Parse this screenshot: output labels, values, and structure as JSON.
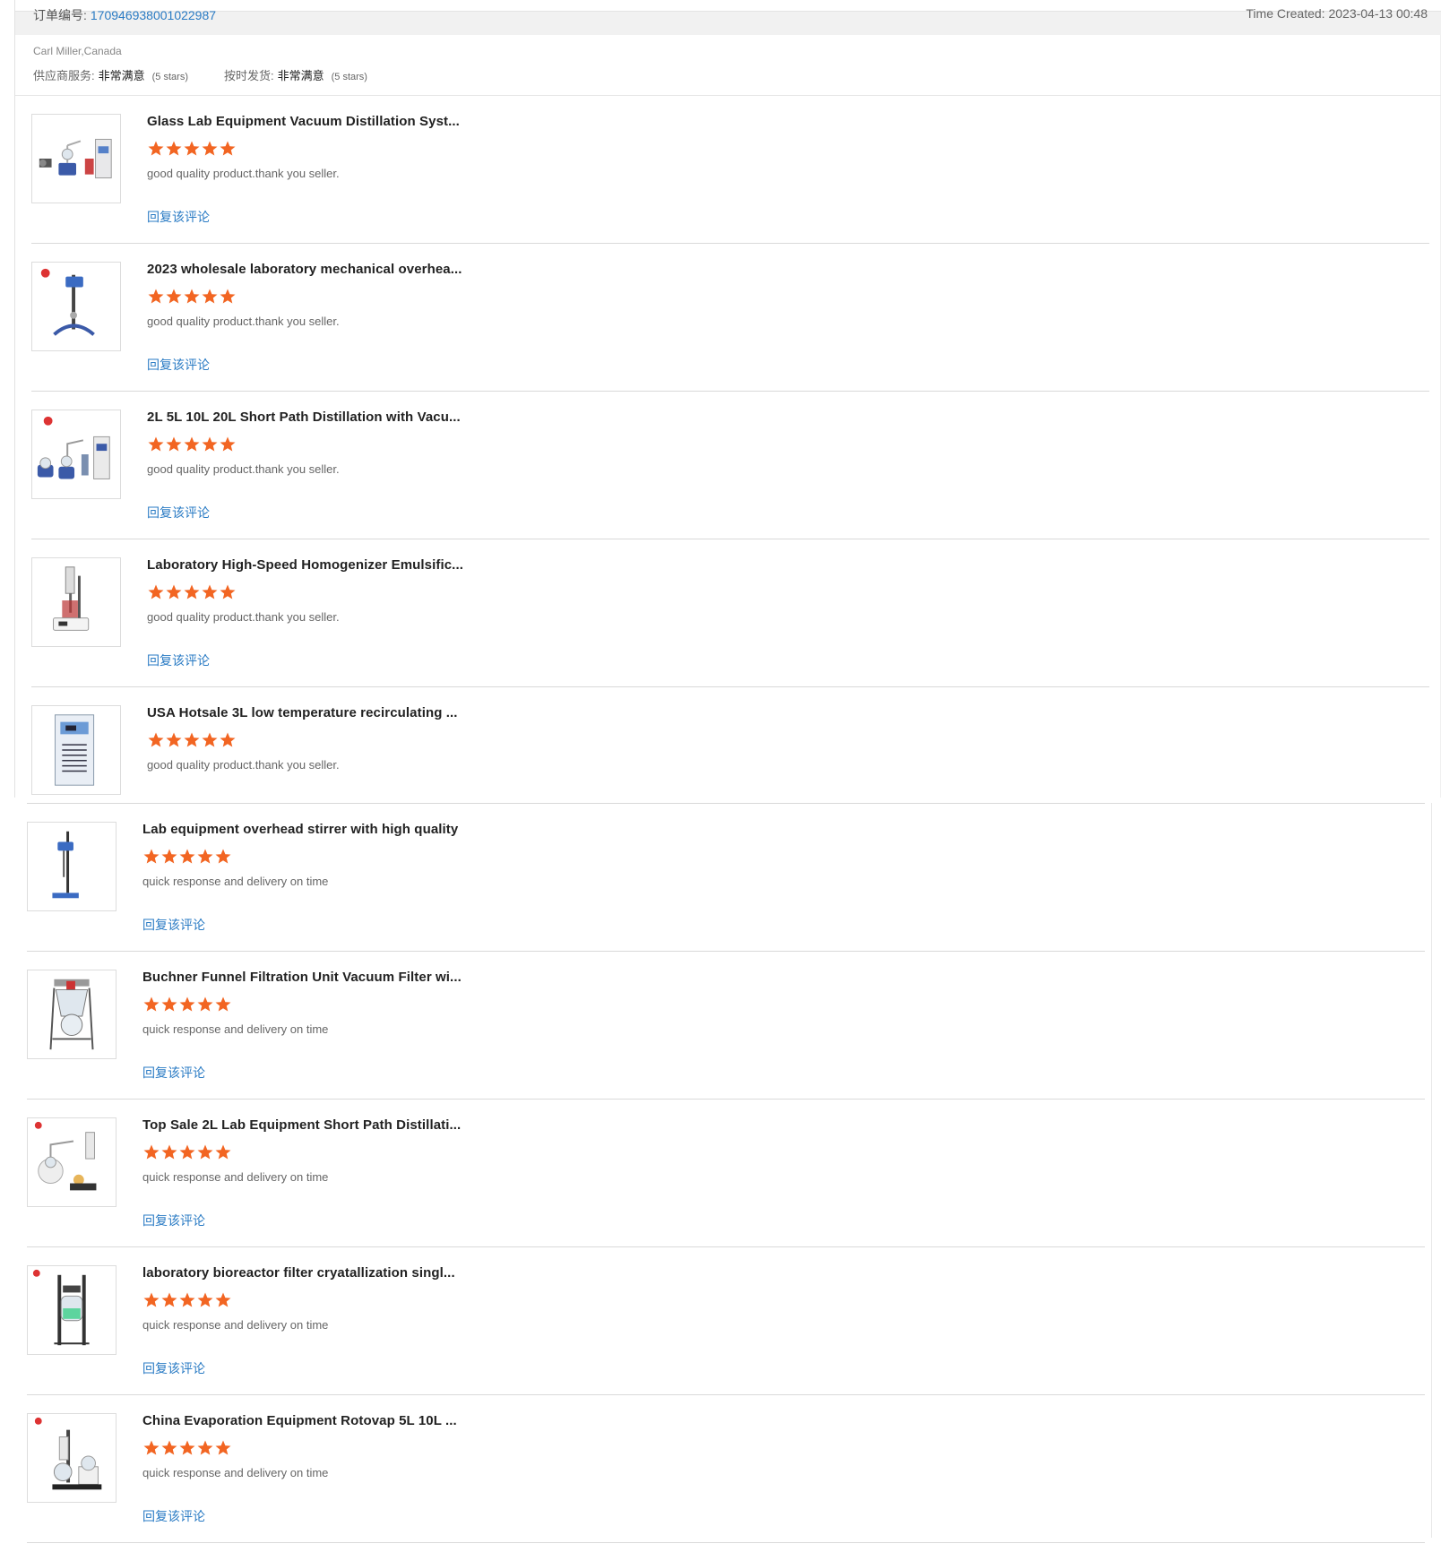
{
  "order_header": {
    "order_label": "订单编号:",
    "order_number": "170946938001022987",
    "time_created": "Time Created: 2023-04-13 00:48"
  },
  "buyer": {
    "name_location": "Carl Miller,Canada"
  },
  "seller_ratings": [
    {
      "key": "供应商服务:",
      "value": "非常满意",
      "stars_text": "(5 stars)"
    },
    {
      "key": "按时发货:",
      "value": "非常满意",
      "stars_text": "(5 stars)"
    }
  ],
  "colors": {
    "star": "#f26522",
    "link": "#2a7bc4"
  },
  "reply_label": "回复该评论",
  "reviews_top": [
    {
      "title": "Glass Lab Equipment Vacuum Distillation Syst...",
      "rating": 5,
      "comment": "good quality product.thank you seller.",
      "image_icon": "distillation-system-icon"
    },
    {
      "title": "2023 wholesale laboratory mechanical overhea...",
      "rating": 5,
      "comment": "good quality product.thank you seller.",
      "image_icon": "overhead-stirrer-icon"
    },
    {
      "title": "2L 5L 10L 20L Short Path Distillation with Vacu...",
      "rating": 5,
      "comment": "good quality product.thank you seller.",
      "image_icon": "short-path-distillation-icon"
    },
    {
      "title": "Laboratory High-Speed Homogenizer Emulsific...",
      "rating": 5,
      "comment": "good quality product.thank you seller.",
      "image_icon": "homogenizer-icon"
    },
    {
      "title": "USA Hotsale 3L low temperature recirculating ...",
      "rating": 5,
      "comment": "good quality product.thank you seller.",
      "image_icon": "chiller-icon"
    }
  ],
  "reviews_bottom": [
    {
      "title": "Lab equipment overhead stirrer with high quality",
      "rating": 5,
      "comment": "quick response and delivery on time",
      "image_icon": "overhead-stirrer-stand-icon"
    },
    {
      "title": "Buchner Funnel Filtration Unit Vacuum Filter wi...",
      "rating": 5,
      "comment": "quick response and delivery on time",
      "image_icon": "filtration-unit-icon"
    },
    {
      "title": "Top Sale 2L Lab Equipment Short Path Distillati...",
      "rating": 5,
      "comment": "quick response and delivery on time",
      "image_icon": "short-path-kit-icon"
    },
    {
      "title": "laboratory bioreactor filter cryatallization singl...",
      "rating": 5,
      "comment": "quick response and delivery on time",
      "image_icon": "glass-reactor-icon"
    },
    {
      "title": "China Evaporation Equipment Rotovap 5L 10L ...",
      "rating": 5,
      "comment": "quick response and delivery on time",
      "image_icon": "rotary-evaporator-icon"
    }
  ]
}
